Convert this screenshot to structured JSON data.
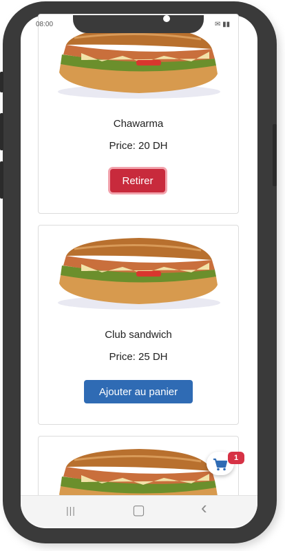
{
  "status": {
    "time": "08:00",
    "icons": "✉ ▮▮"
  },
  "products": [
    {
      "name": "Chawarma",
      "price": "Price: 20 DH",
      "action_label": "Retirer"
    },
    {
      "name": "Club sandwich",
      "price": "Price: 25 DH",
      "action_label": "Ajouter au panier"
    },
    {
      "name": "",
      "price": "",
      "action_label": ""
    }
  ],
  "cart": {
    "count": "1",
    "icon": "cart-icon"
  },
  "nav": {
    "recents_glyph": "|||",
    "home_glyph": "▢",
    "back_glyph": "‹"
  },
  "colors": {
    "remove_button": "#c82a3c",
    "add_button": "#2f6bb4",
    "badge": "#d63245",
    "cart_icon": "#2f6bb4"
  }
}
